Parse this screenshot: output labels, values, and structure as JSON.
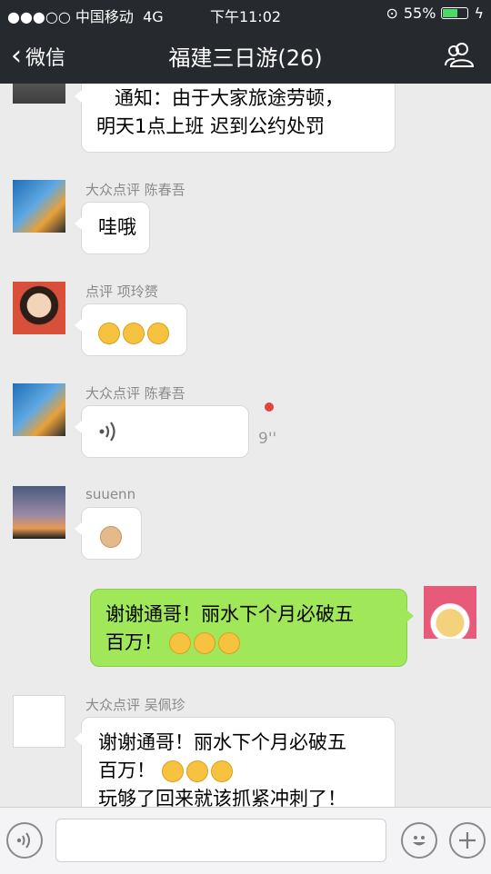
{
  "status_bar": {
    "carrier": "●●●○○ 中国移动",
    "network": "4G",
    "time": "下午11:02",
    "battery": "55%"
  },
  "nav": {
    "back_label": "微信",
    "title": "福建三日游(26)"
  },
  "messages": [
    {
      "text_lines": [
        "通知：由于大家旅途劳顿，",
        "明天1点上班 迟到公约处罚"
      ]
    },
    {
      "sender": "大众点评 陈春吾",
      "text": "哇哦"
    },
    {
      "sender": "点评 项玲赟",
      "emoji": [
        "laugh-tears-emoji",
        "laugh-tears-emoji",
        "laugh-tears-emoji"
      ]
    },
    {
      "sender": "大众点评 陈春吾",
      "voice_duration": "9''"
    },
    {
      "sender": "suuenn",
      "emoji": [
        "ok-hand-emoji"
      ]
    },
    {
      "self": true,
      "line1": "谢谢通哥！丽水下个月必破五",
      "line2": "百万！",
      "emoji": [
        "determined-emoji",
        "determined-emoji",
        "determined-emoji"
      ]
    },
    {
      "sender": "大众点评 吴佩珍",
      "line1": "谢谢通哥！丽水下个月必破五",
      "line2": "百万！",
      "line3": "玩够了回来就该抓紧冲刺了！"
    }
  ],
  "colors": {
    "bar": "#26292e",
    "bg": "#ebebeb",
    "green_bubble": "#a0e75a",
    "unread": "#e64340"
  }
}
